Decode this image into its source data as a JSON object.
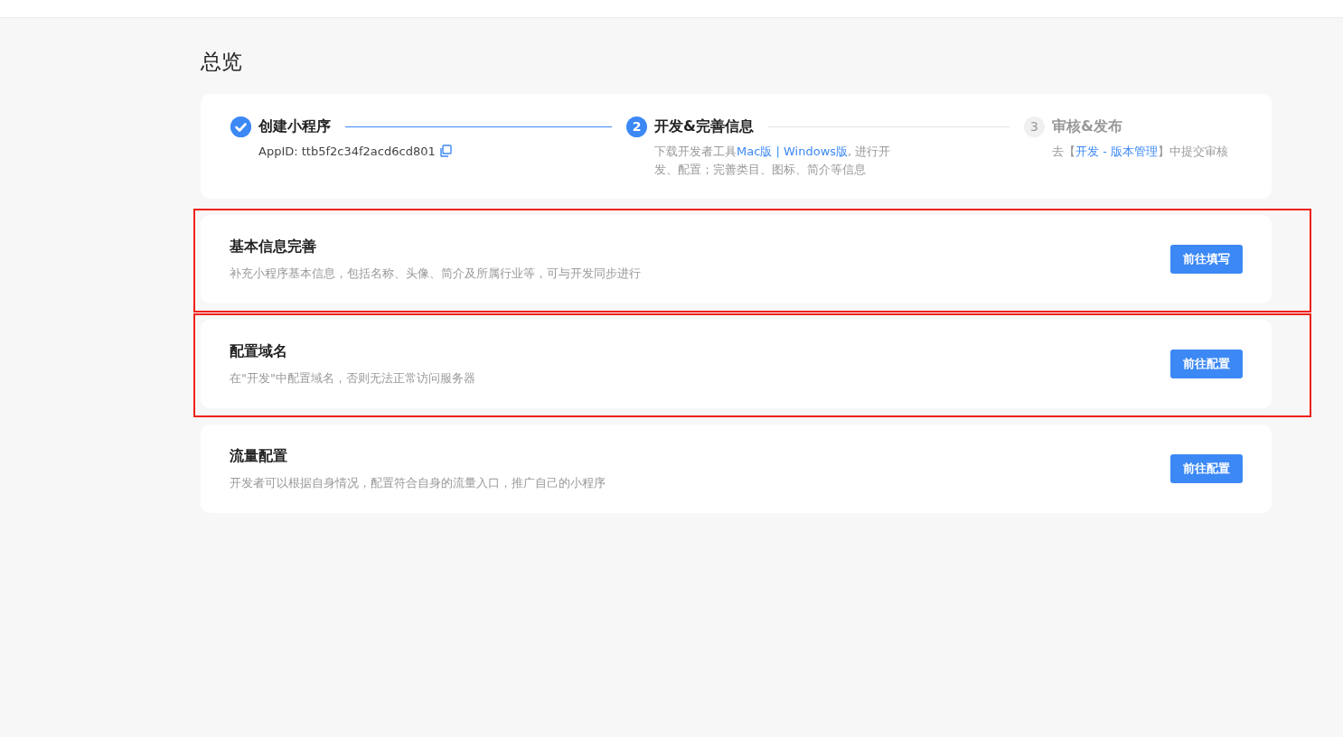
{
  "page_title": "总览",
  "steps": [
    {
      "kind": "done",
      "title": "创建小程序",
      "description": [
        {
          "kind": "text",
          "text": "AppID: ttb5f2c34f2acd6cd801"
        },
        {
          "kind": "copy"
        }
      ]
    },
    {
      "kind": "current",
      "number": "2",
      "title": "开发&完善信息",
      "description": [
        {
          "kind": "text",
          "text": "下载开发者工具"
        },
        {
          "kind": "link",
          "text": "Mac版"
        },
        {
          "kind": "link",
          "text": " | "
        },
        {
          "kind": "link",
          "text": "Windows版"
        },
        {
          "kind": "text",
          "text": ", 进行开发、配置；完善类目、图标、简介等信息"
        }
      ]
    },
    {
      "kind": "pending",
      "number": "3",
      "title": "审核&发布",
      "description": [
        {
          "kind": "text",
          "text": "去【"
        },
        {
          "kind": "link",
          "text": "开发 - 版本管理"
        },
        {
          "kind": "text",
          "text": "】中提交审核"
        }
      ]
    }
  ],
  "tasks": [
    {
      "title": "基本信息完善",
      "description": "补充小程序基本信息，包括名称、头像、简介及所属行业等，可与开发同步进行",
      "button": "前往填写",
      "highlighted": true
    },
    {
      "title": "配置域名",
      "description": "在\"开发\"中配置域名，否则无法正常访问服务器",
      "button": "前往配置",
      "highlighted": true
    },
    {
      "title": "流量配置",
      "description": "开发者可以根据自身情况，配置符合自身的流量入口，推广自己的小程序",
      "button": "前往配置",
      "highlighted": false
    }
  ]
}
